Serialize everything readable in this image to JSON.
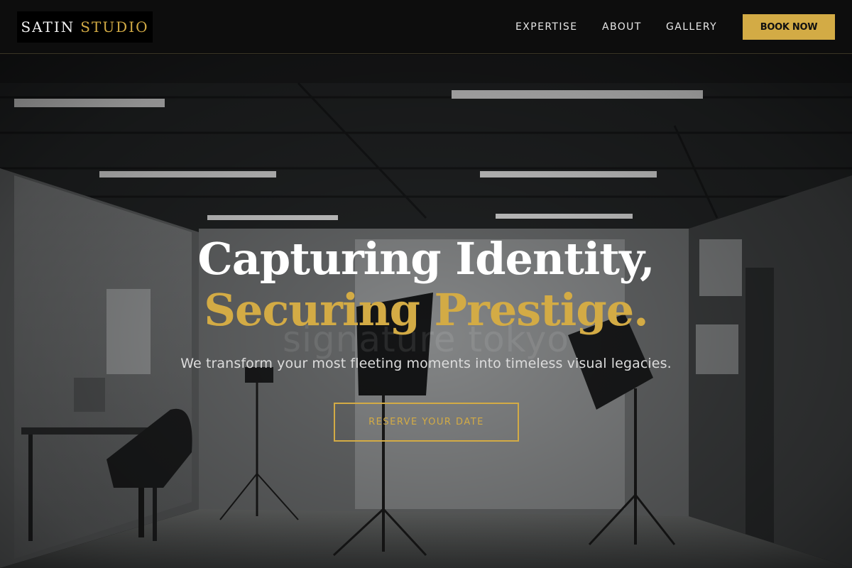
{
  "brand": {
    "name_primary": "SATIN",
    "name_accent": "STUDIO"
  },
  "nav": {
    "items": [
      {
        "label": "EXPERTISE"
      },
      {
        "label": "ABOUT"
      },
      {
        "label": "GALLERY"
      }
    ],
    "cta_label": "BOOK NOW"
  },
  "hero": {
    "headline_line1": "Capturing Identity,",
    "headline_line2": "Securing Prestige.",
    "background_text": "signature tokyo",
    "subtitle": "We transform your most fleeting moments into timeless visual legacies.",
    "cta_label": "RESERVE YOUR DATE",
    "background_scene": "photo-studio-interior"
  },
  "colors": {
    "accent_gold": "#d3ab45",
    "header_bg": "#0d0d0d",
    "text_white": "#ffffff"
  }
}
